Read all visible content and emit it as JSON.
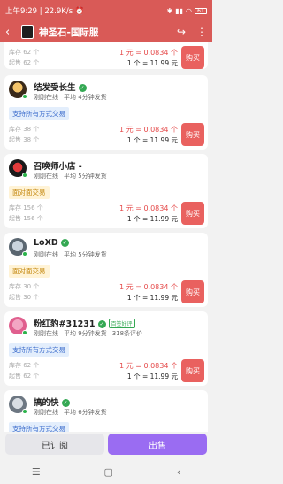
{
  "status_bar": {
    "left_text": "上午9:29 | 22.9K/s ⏰",
    "battery": "61"
  },
  "app_bar": {
    "title": "神圣石-国际服"
  },
  "common": {
    "buy_label": "购买",
    "stock_prefix": "库存",
    "min_prefix": "起售",
    "unit_suffix": "个",
    "price_red_text": "1 元 = 0.0834 个",
    "price_black_text": "1 个 = 11.99 元",
    "online_text": "刚刚在线"
  },
  "cards": [
    {
      "name": "",
      "trade_tag": "",
      "stock_line": "库存 62 个",
      "min_line": "起售 62 个",
      "price_red": "1 元 = 0.0834 个",
      "price_black": "1 个 = 11.99 元"
    },
    {
      "name": "结发受长生",
      "avg_ship": "平均 4分钟发货",
      "trade_tag": "支持所有方式交易",
      "stock_line": "库存 38 个",
      "min_line": "起售 38 个",
      "price_red": "1 元 = 0.0834 个",
      "price_black": "1 个 = 11.99 元"
    },
    {
      "name": "召唤师小店 -",
      "avg_ship": "平均 5分钟发货",
      "trade_tag": "面对面交易",
      "stock_line": "库存 156 个",
      "min_line": "起售 156 个",
      "price_red": "1 元 = 0.0834 个",
      "price_black": "1 个 = 11.99 元"
    },
    {
      "name": "LoXD",
      "avg_ship": "平均 5分钟发货",
      "trade_tag": "面对面交易",
      "stock_line": "库存 30 个",
      "min_line": "起售 30 个",
      "price_red": "1 元 = 0.0834 个",
      "price_black": "1 个 = 11.99 元"
    },
    {
      "name": "粉红豹#31231",
      "badge": "百签好评",
      "avg_ship": "平均 9分钟发货",
      "reviews": "318条评价",
      "trade_tag": "支持所有方式交易",
      "stock_line": "库存 62 个",
      "min_line": "起售 62 个",
      "price_red": "1 元 = 0.0834 个",
      "price_black": "1 个 = 11.99 元"
    },
    {
      "name": "搞的快",
      "avg_ship": "平均 6分钟发货",
      "trade_tag": "支持所有方式交易",
      "stock_line": "",
      "min_line": "",
      "price_red": "",
      "price_black": ""
    }
  ],
  "bottom": {
    "subscribed_label": "已订阅",
    "sell_label": "出售"
  },
  "nav": {
    "menu_glyph": "☰",
    "home_glyph": "▢",
    "back_glyph": "‹"
  },
  "colors": {
    "brand_red": "#d95a57",
    "buy_button": "#e9615f",
    "sell_button": "#9a6cf2",
    "price_red": "#e54b4b",
    "online_green": "#2bb34a"
  }
}
